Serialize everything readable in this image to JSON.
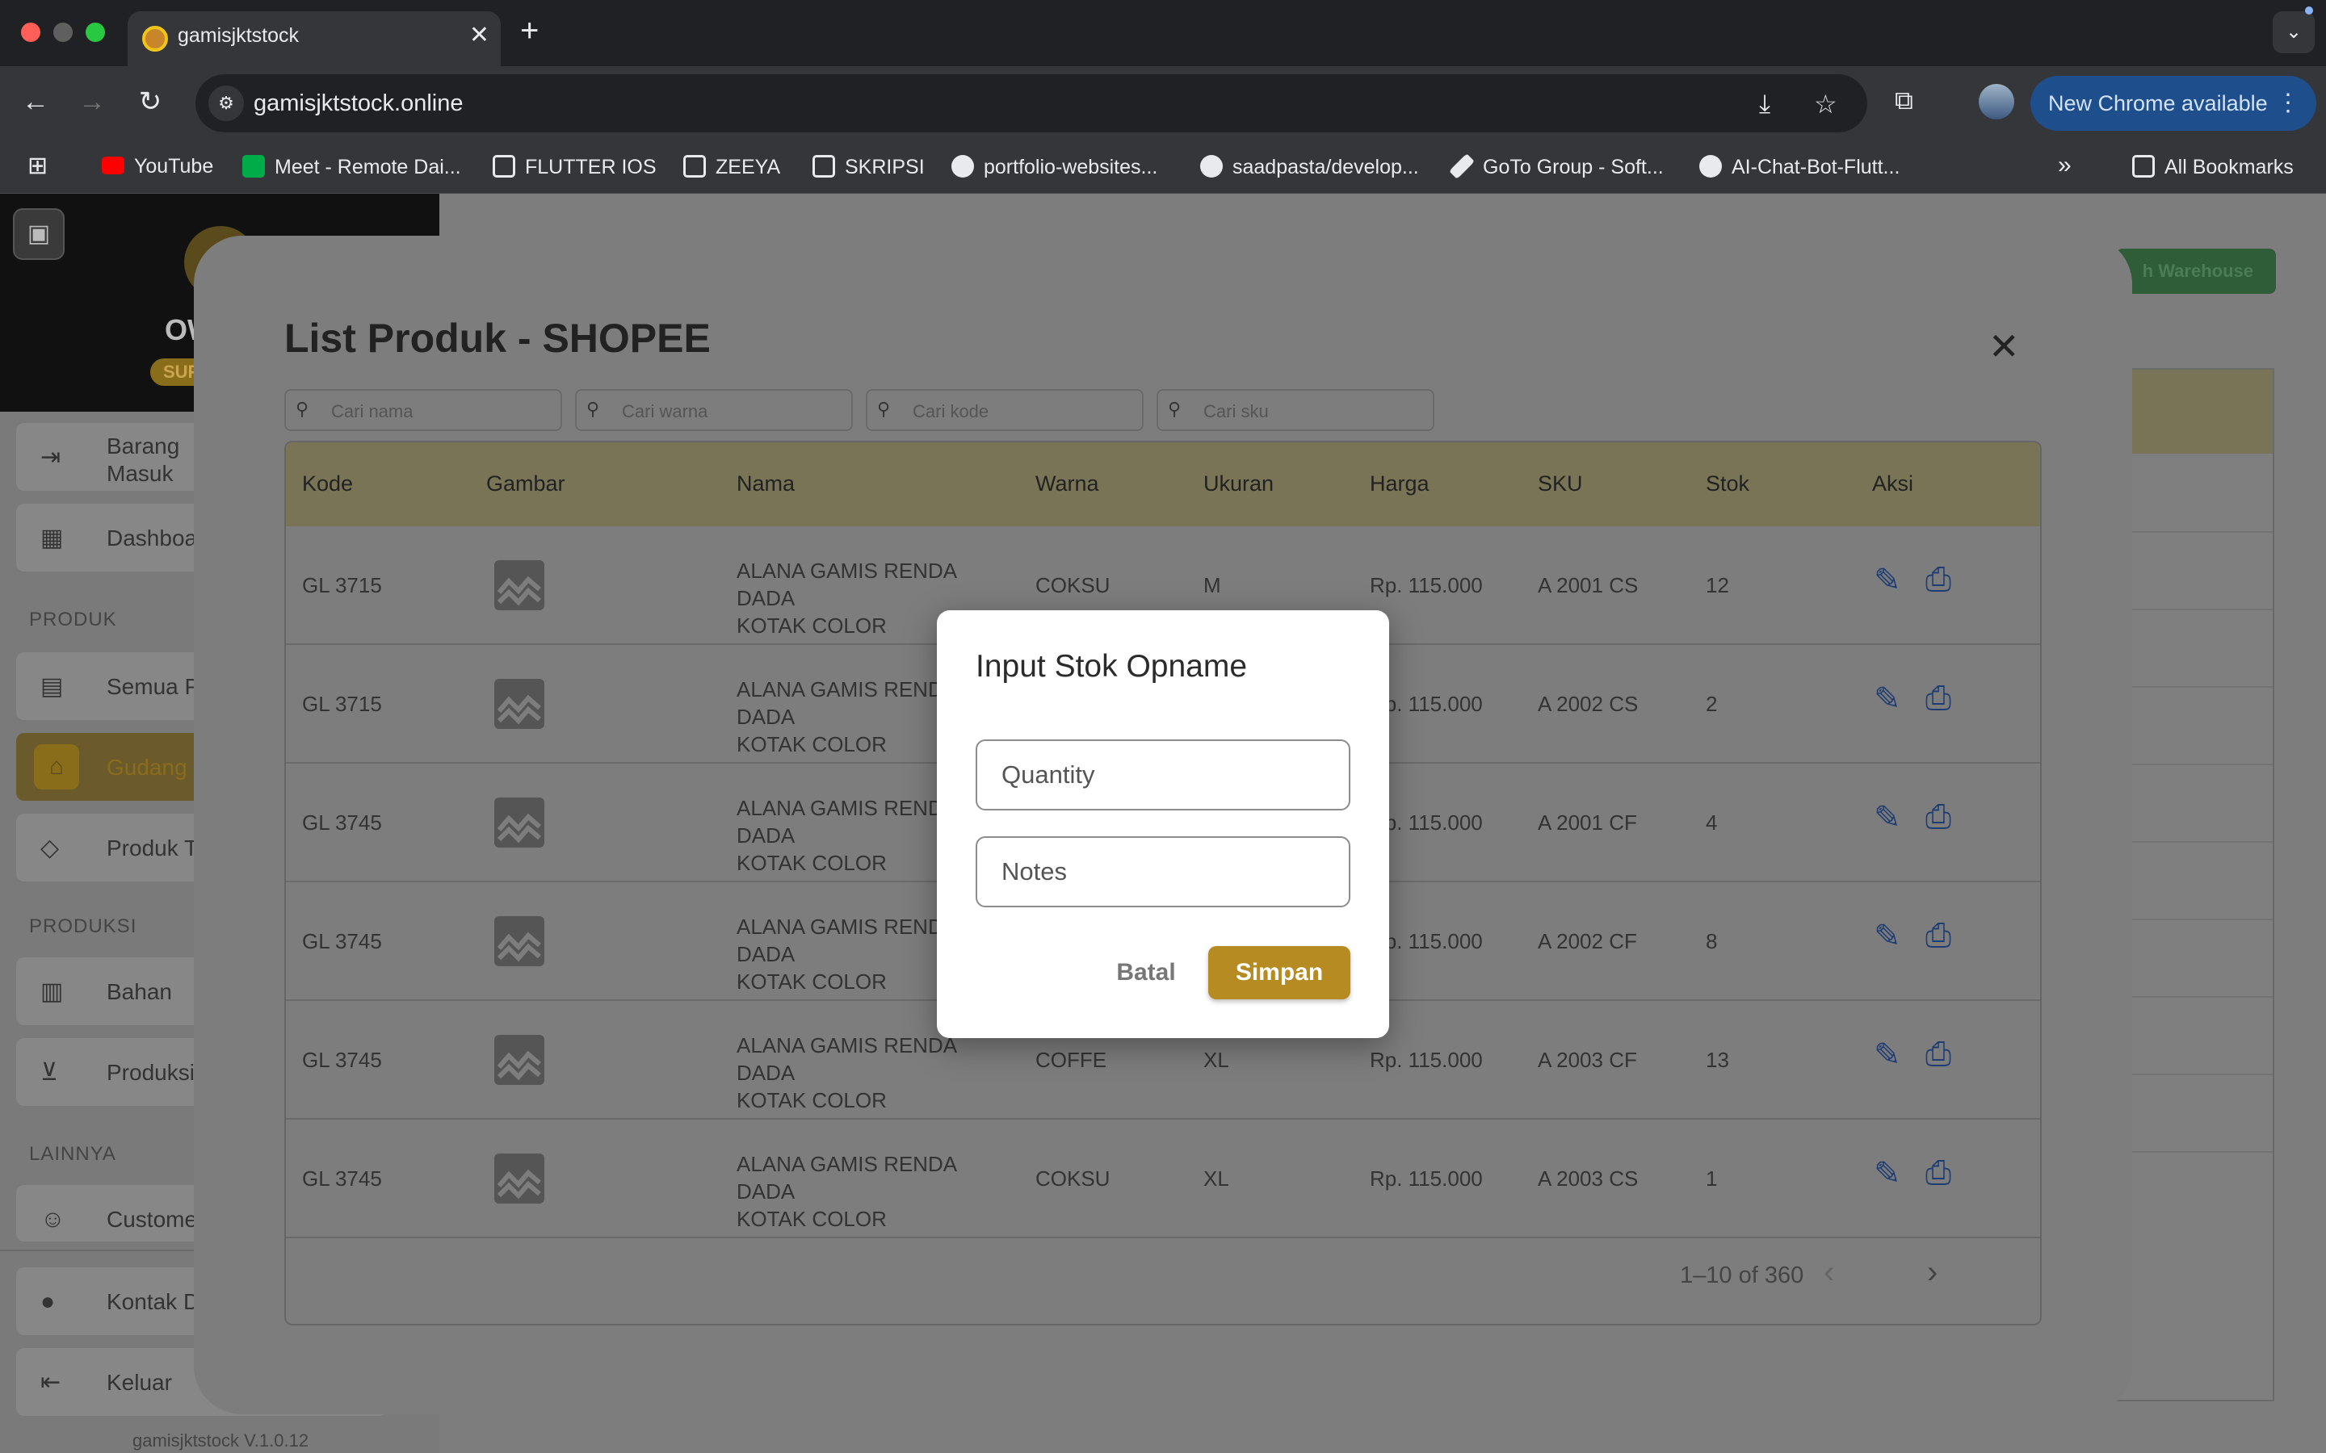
{
  "browser": {
    "tab_title": "gamisjktstock",
    "url": "gamisjktstock.online",
    "new_chrome_label": "New Chrome available",
    "bookmarks": [
      {
        "label": "YouTube",
        "icon": "youtube-icon",
        "color": "#ff0000"
      },
      {
        "label": "Meet - Remote Dai...",
        "icon": "meet-icon",
        "color": "#00ac47"
      },
      {
        "label": "FLUTTER IOS",
        "icon": "folder-icon"
      },
      {
        "label": "ZEEYA",
        "icon": "folder-icon"
      },
      {
        "label": "SKRIPSI",
        "icon": "folder-icon"
      },
      {
        "label": "portfolio-websites...",
        "icon": "github-icon"
      },
      {
        "label": "saadpasta/develop...",
        "icon": "github-icon"
      },
      {
        "label": "GoTo Group - Soft...",
        "icon": "pen-icon"
      },
      {
        "label": "AI-Chat-Bot-Flutt...",
        "icon": "github-icon"
      }
    ],
    "all_bookmarks_label": "All Bookmarks"
  },
  "sidebar": {
    "user_initials": "OW",
    "role_badge": "SUP",
    "items_top": [
      {
        "label": "Barang\nMasuk",
        "icon": "inbox-arrow-icon"
      },
      {
        "label": "Dashboard",
        "icon": "dashboard-icon"
      }
    ],
    "section_produk": "PRODUK",
    "items_produk": [
      {
        "label": "Semua P",
        "icon": "archive-icon"
      },
      {
        "label": "Gudang",
        "icon": "warehouse-icon"
      },
      {
        "label": "Produk Te",
        "icon": "tag-icon"
      }
    ],
    "section_produksi": "PRODUKSI",
    "items_produksi": [
      {
        "label": "Bahan",
        "icon": "grid-icon"
      },
      {
        "label": "Produksi",
        "icon": "cart-icon"
      }
    ],
    "section_lainnya": "LAINNYA",
    "items_lainnya": [
      {
        "label": "Custome",
        "icon": "person-add-icon"
      },
      {
        "label": "Kontak D",
        "icon": "person-icon"
      },
      {
        "label": "Keluar",
        "icon": "logout-icon"
      }
    ],
    "version": "gamisjktstock V.1.0.12"
  },
  "background": {
    "warehouse_button": "h Warehouse"
  },
  "modal": {
    "title": "List Produk - SHOPEE",
    "filters": [
      "Cari nama",
      "Cari warna",
      "Cari kode",
      "Cari sku"
    ],
    "columns": [
      "Kode",
      "Gambar",
      "Nama",
      "Warna",
      "Ukuran",
      "Harga",
      "SKU",
      "Stok",
      "Aksi"
    ],
    "rows": [
      {
        "kode": "GL 3715",
        "nama": "ALANA GAMIS RENDA DADA\nKOTAK COLOR",
        "warna": "COKSU",
        "ukuran": "M",
        "harga": "Rp. 115.000",
        "sku": "A 2001 CS",
        "stok": "12"
      },
      {
        "kode": "GL 3715",
        "nama": "ALANA GAMIS RENDA DADA\nKOTAK COLOR",
        "warna": "",
        "ukuran": "",
        "harga": "Rp. 115.000",
        "sku": "A 2002 CS",
        "stok": "2"
      },
      {
        "kode": "GL 3745",
        "nama": "ALANA GAMIS RENDA DADA\nKOTAK COLOR",
        "warna": "",
        "ukuran": "",
        "harga": "Rp. 115.000",
        "sku": "A 2001 CF",
        "stok": "4"
      },
      {
        "kode": "GL 3745",
        "nama": "ALANA GAMIS RENDA DADA\nKOTAK COLOR",
        "warna": "",
        "ukuran": "",
        "harga": "Rp. 115.000",
        "sku": "A 2002 CF",
        "stok": "8"
      },
      {
        "kode": "GL 3745",
        "nama": "ALANA GAMIS RENDA DADA\nKOTAK COLOR",
        "warna": "COFFE",
        "ukuran": "XL",
        "harga": "Rp. 115.000",
        "sku": "A 2003 CF",
        "stok": "13"
      },
      {
        "kode": "GL 3745",
        "nama": "ALANA GAMIS RENDA DADA\nKOTAK COLOR",
        "warna": "COKSU",
        "ukuran": "XL",
        "harga": "Rp. 115.000",
        "sku": "A 2003 CS",
        "stok": "1"
      }
    ],
    "pagination": "1–10 of 360"
  },
  "dialog": {
    "title": "Input Stok Opname",
    "quantity_placeholder": "Quantity",
    "notes_placeholder": "Notes",
    "cancel_label": "Batal",
    "save_label": "Simpan"
  },
  "colors": {
    "accent": "#b58b22",
    "header_bg": "#7a7456",
    "action_icon": "#1f3d73"
  }
}
